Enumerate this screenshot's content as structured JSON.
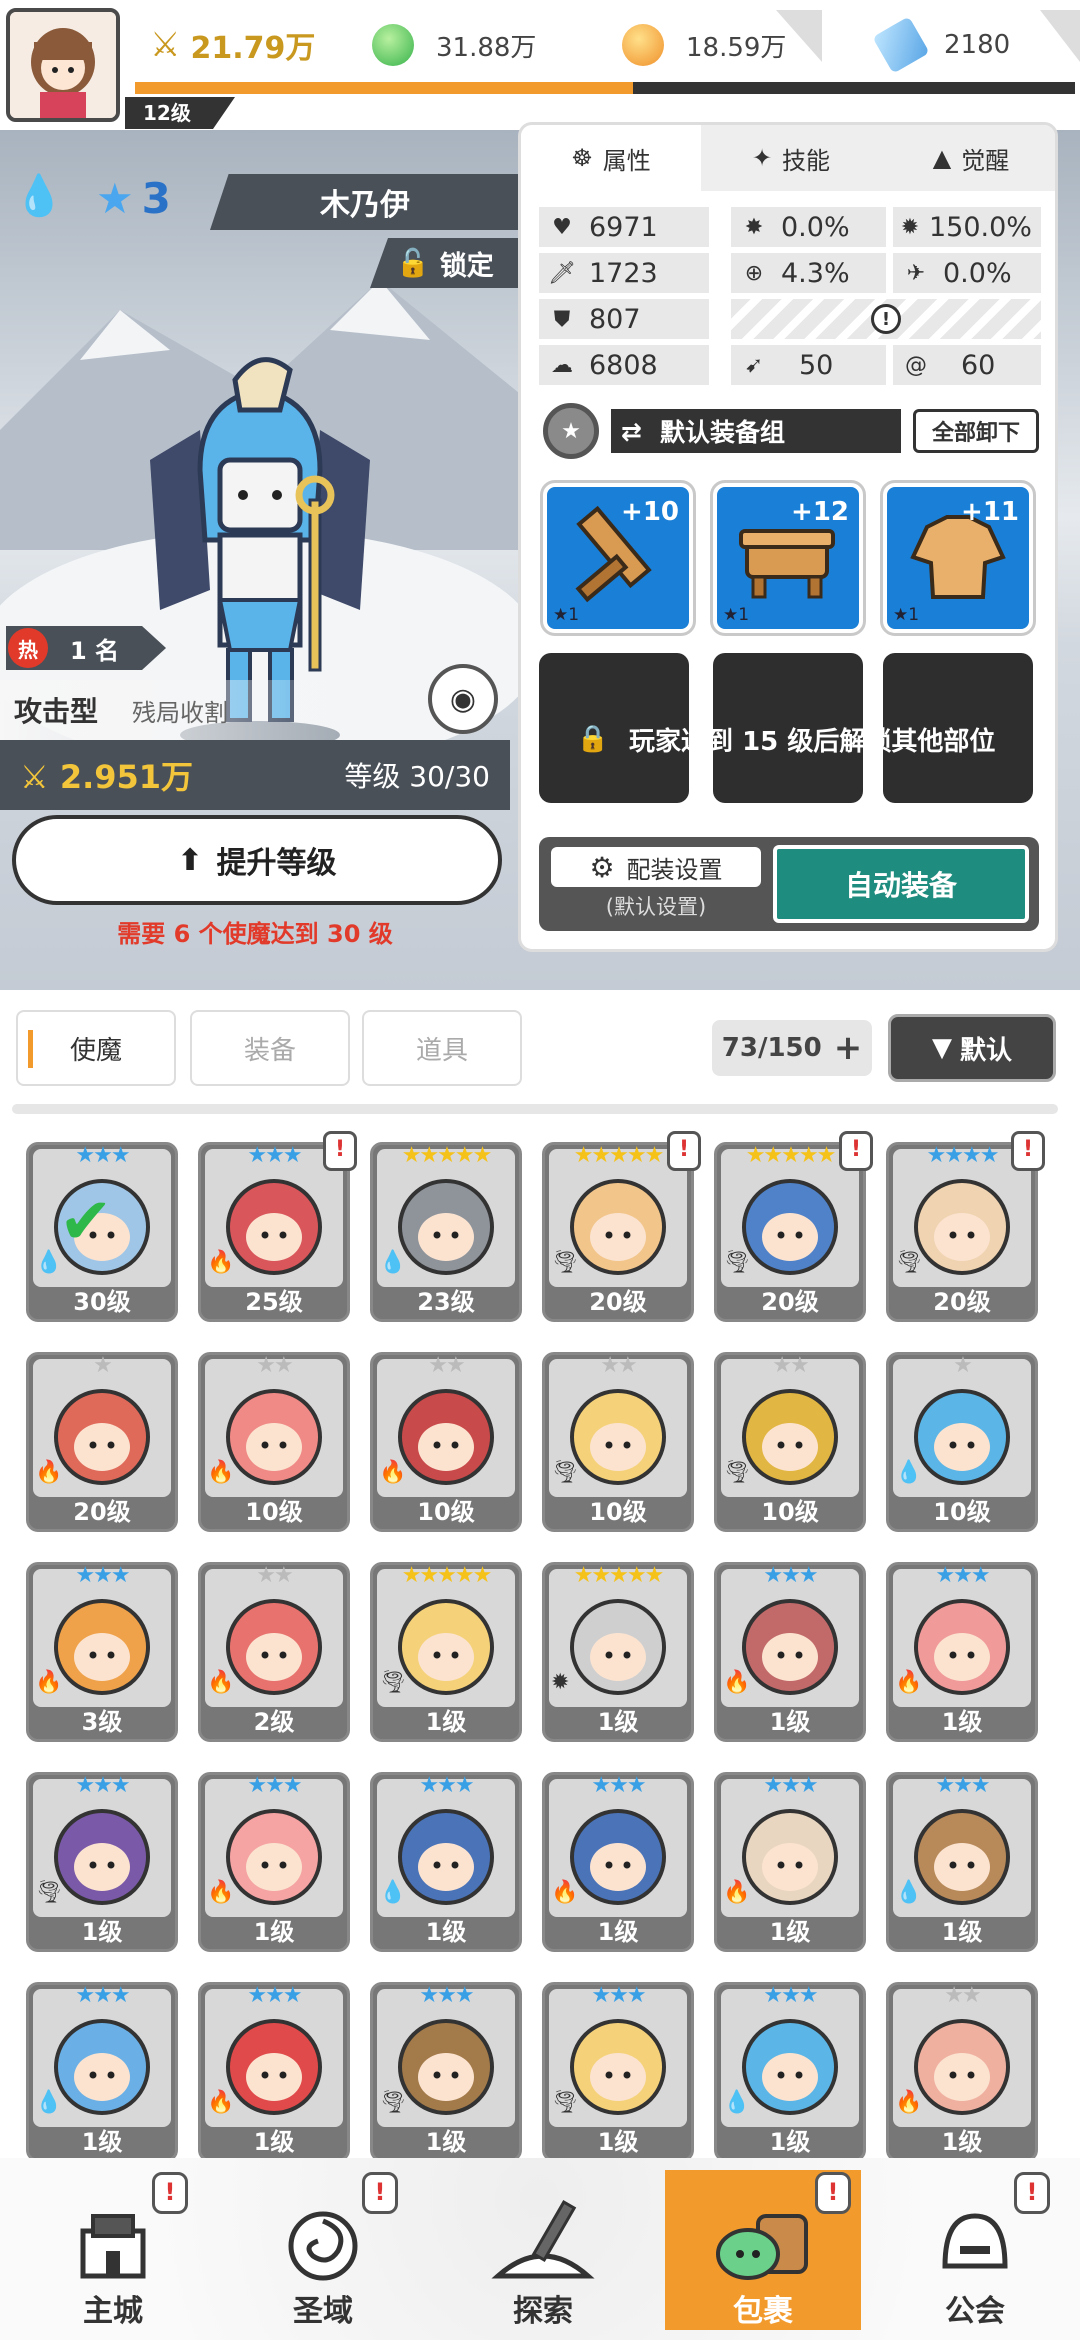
{
  "top": {
    "level": "12级",
    "power": "21.79万",
    "green_currency": "31.88万",
    "gold_currency": "18.59万",
    "gem": "2180",
    "xp_fraction": 0.53
  },
  "hero": {
    "stars": "3",
    "name": "木乃伊",
    "lock_label": "锁定",
    "hot_label": "热",
    "rank": "1 名",
    "type": "攻击型",
    "trait": "残局收割",
    "power": "2.951万",
    "level_text": "等级 30/30",
    "upgrade_label": "提升等级",
    "upgrade_hint": "需要 6 个使魔达到 30 级"
  },
  "panel": {
    "tabs": [
      "属性",
      "技能",
      "觉醒"
    ],
    "stats": {
      "hp": "6971",
      "atk": "1723",
      "def": "807",
      "spd": "6808",
      "crit": "0.0%",
      "crit_dmg": "150.0%",
      "acc": "4.3%",
      "eva": "0.0%",
      "s1": "50",
      "s2": "60"
    },
    "equip_group": "默认装备组",
    "unequip_all": "全部卸下",
    "equips": [
      {
        "plus": "+10",
        "star": "★1"
      },
      {
        "plus": "+12",
        "star": "★1"
      },
      {
        "plus": "+11",
        "star": "★1"
      }
    ],
    "locked_text": "玩家达到 15 级后解锁其他部位",
    "config_label": "配装设置",
    "config_sub": "(默认设置)",
    "auto_equip": "自动装备"
  },
  "list": {
    "tabs": [
      "使魔",
      "装备",
      "道具"
    ],
    "count": "73/150",
    "sort": "默认",
    "cards": [
      {
        "level": "30级",
        "stars": 3,
        "alert": false,
        "color": "#9fc6e6"
      },
      {
        "level": "25级",
        "stars": 3,
        "alert": true,
        "color": "#d9565b"
      },
      {
        "level": "23级",
        "stars": 5,
        "alert": false,
        "color": "#8f949b"
      },
      {
        "level": "20级",
        "stars": 5,
        "alert": true,
        "color": "#f2c58a"
      },
      {
        "level": "20级",
        "stars": 5,
        "alert": true,
        "color": "#4f82c9"
      },
      {
        "level": "20级",
        "stars": 4,
        "alert": true,
        "color": "#f0d3b0"
      },
      {
        "level": "20级",
        "stars": 1,
        "alert": false,
        "color": "#e06a5a"
      },
      {
        "level": "10级",
        "stars": 2,
        "alert": false,
        "color": "#f08a86"
      },
      {
        "level": "10级",
        "stars": 2,
        "alert": false,
        "color": "#c94a4a"
      },
      {
        "level": "10级",
        "stars": 2,
        "alert": false,
        "color": "#f5d27a"
      },
      {
        "level": "10级",
        "stars": 2,
        "alert": false,
        "color": "#e2b642"
      },
      {
        "level": "10级",
        "stars": 1,
        "alert": false,
        "color": "#5bb5e6"
      },
      {
        "level": "3级",
        "stars": 3,
        "alert": false,
        "color": "#f0a24a"
      },
      {
        "level": "2级",
        "stars": 2,
        "alert": false,
        "color": "#e8736e"
      },
      {
        "level": "1级",
        "stars": 5,
        "alert": false,
        "color": "#f5d27a"
      },
      {
        "level": "1级",
        "stars": 5,
        "alert": false,
        "color": "#cfcfcf"
      },
      {
        "level": "1级",
        "stars": 3,
        "alert": false,
        "color": "#c26a6a"
      },
      {
        "level": "1级",
        "stars": 3,
        "alert": false,
        "color": "#f09a9a"
      },
      {
        "level": "1级",
        "stars": 3,
        "alert": false,
        "color": "#7a5aa8"
      },
      {
        "level": "1级",
        "stars": 3,
        "alert": false,
        "color": "#f5a3a3"
      },
      {
        "level": "1级",
        "stars": 3,
        "alert": false,
        "color": "#4a73b8"
      },
      {
        "level": "1级",
        "stars": 3,
        "alert": false,
        "color": "#4a73b8"
      },
      {
        "level": "1级",
        "stars": 3,
        "alert": false,
        "color": "#e8d6c0"
      },
      {
        "level": "1级",
        "stars": 3,
        "alert": false,
        "color": "#b88a5a"
      },
      {
        "level": "1级",
        "stars": 3,
        "alert": false,
        "color": "#6ab0e6"
      },
      {
        "level": "1级",
        "stars": 3,
        "alert": false,
        "color": "#e04a4a"
      },
      {
        "level": "1级",
        "stars": 3,
        "alert": false,
        "color": "#a37a4a"
      },
      {
        "level": "1级",
        "stars": 3,
        "alert": false,
        "color": "#f5d27a"
      },
      {
        "level": "1级",
        "stars": 3,
        "alert": false,
        "color": "#5bb5e6"
      },
      {
        "level": "1级",
        "stars": 2,
        "alert": false,
        "color": "#f0b0a0"
      }
    ]
  },
  "nav": {
    "items": [
      {
        "label": "主城",
        "alert": true
      },
      {
        "label": "圣域",
        "alert": true
      },
      {
        "label": "探索",
        "alert": false
      },
      {
        "label": "包裹",
        "alert": true
      },
      {
        "label": "公会",
        "alert": true
      }
    ],
    "active": 3
  },
  "colors": {
    "accent": "#f39a2c",
    "teal": "#1e8c7e",
    "dark": "#333333",
    "red": "#e23a2a"
  }
}
